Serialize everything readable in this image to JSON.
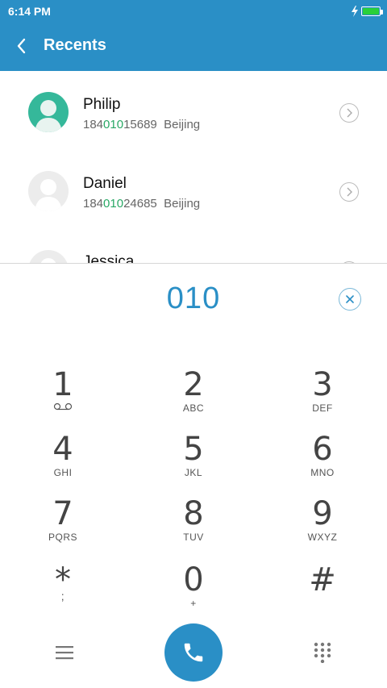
{
  "status": {
    "time": "6:14 PM",
    "battery_level": 1.0,
    "battery_color": "#29d03a"
  },
  "appbar": {
    "title": "Recents",
    "color": "#2a8fc6"
  },
  "recents": [
    {
      "name": "Philip",
      "number_prefix": "184",
      "number_match": "010",
      "number_suffix": "15689",
      "location": "Beijing",
      "avatar": "teal"
    },
    {
      "name": "Daniel",
      "number_prefix": "184",
      "number_match": "010",
      "number_suffix": "24685",
      "location": "Beijing",
      "avatar": "gray"
    },
    {
      "name": "Jessica",
      "avatar": "gray"
    }
  ],
  "dialer": {
    "input": "010",
    "keys": [
      {
        "digit": "1",
        "letters": ""
      },
      {
        "digit": "2",
        "letters": "ABC"
      },
      {
        "digit": "3",
        "letters": "DEF"
      },
      {
        "digit": "4",
        "letters": "GHI"
      },
      {
        "digit": "5",
        "letters": "JKL"
      },
      {
        "digit": "6",
        "letters": "MNO"
      },
      {
        "digit": "7",
        "letters": "PQRS"
      },
      {
        "digit": "8",
        "letters": "TUV"
      },
      {
        "digit": "9",
        "letters": "WXYZ"
      },
      {
        "digit": "*",
        "letters": ";"
      },
      {
        "digit": "0",
        "letters": "+"
      },
      {
        "digit": "#",
        "letters": ""
      }
    ]
  },
  "icons": {
    "menu": "menu-icon",
    "call": "phone-icon",
    "keypad": "keypad-icon",
    "back": "chevron-left-icon",
    "clear": "clear-icon",
    "info": "chevron-right-icon"
  }
}
